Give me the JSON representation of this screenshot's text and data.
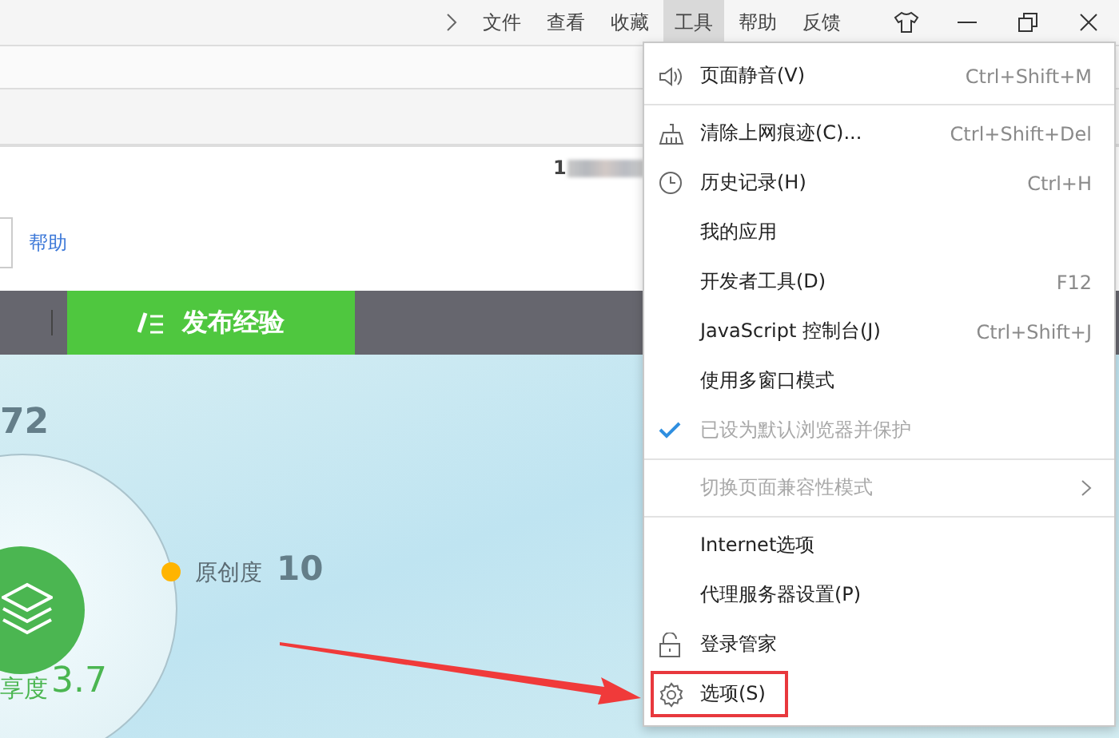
{
  "menu_bar": {
    "menus": [
      {
        "label": "文件",
        "selected": false
      },
      {
        "label": "查看",
        "selected": false
      },
      {
        "label": "收藏",
        "selected": false
      },
      {
        "label": "工具",
        "selected": true
      },
      {
        "label": "帮助",
        "selected": false
      },
      {
        "label": "反馈",
        "selected": false
      }
    ]
  },
  "page": {
    "user_id": "1",
    "help_link": "帮助",
    "publish_button": "发布经验"
  },
  "stats": {
    "top_value": "72",
    "ring_label": "原创度",
    "ring_value": "10",
    "center_label": "享度",
    "center_value": "3.7"
  },
  "tools_menu": {
    "items": [
      {
        "kind": "mute",
        "label": "页面静音(V)",
        "shortcut": "Ctrl+Shift+M",
        "disabled": false,
        "checked": false,
        "submenu": false,
        "highlighted": false
      },
      {
        "kind": "separator"
      },
      {
        "kind": "clear",
        "label": "清除上网痕迹(C)...",
        "shortcut": "Ctrl+Shift+Del",
        "disabled": false,
        "checked": false,
        "submenu": false,
        "highlighted": false
      },
      {
        "kind": "history",
        "label": "历史记录(H)",
        "shortcut": "Ctrl+H",
        "disabled": false,
        "checked": false,
        "submenu": false,
        "highlighted": false
      },
      {
        "kind": "item",
        "label": "我的应用",
        "disabled": false,
        "checked": false,
        "submenu": false,
        "highlighted": false
      },
      {
        "kind": "item",
        "label": "开发者工具(D)",
        "shortcut": "F12",
        "disabled": false,
        "checked": false,
        "submenu": false,
        "highlighted": false
      },
      {
        "kind": "item",
        "label": "JavaScript 控制台(J)",
        "shortcut": "Ctrl+Shift+J",
        "disabled": false,
        "checked": false,
        "submenu": false,
        "highlighted": false
      },
      {
        "kind": "item",
        "label": "使用多窗口模式",
        "disabled": false,
        "checked": false,
        "submenu": false,
        "highlighted": false
      },
      {
        "kind": "item",
        "label": "已设为默认浏览器并保护",
        "disabled": true,
        "checked": true,
        "submenu": false,
        "highlighted": false
      },
      {
        "kind": "separator"
      },
      {
        "kind": "item",
        "label": "切换页面兼容性模式",
        "disabled": true,
        "checked": false,
        "submenu": true,
        "highlighted": false
      },
      {
        "kind": "separator"
      },
      {
        "kind": "item",
        "label": "Internet选项",
        "disabled": false,
        "checked": false,
        "submenu": false,
        "highlighted": false
      },
      {
        "kind": "item",
        "label": "代理服务器设置(P)",
        "disabled": false,
        "checked": false,
        "submenu": false,
        "highlighted": false
      },
      {
        "kind": "login",
        "label": "登录管家",
        "disabled": false,
        "checked": false,
        "submenu": false,
        "highlighted": false
      },
      {
        "kind": "options",
        "label": "选项(S)",
        "disabled": false,
        "checked": false,
        "submenu": false,
        "highlighted": true
      }
    ]
  }
}
